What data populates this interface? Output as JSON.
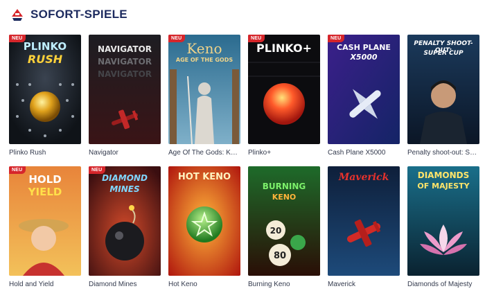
{
  "section": {
    "title": "SOFORT-SPIELE",
    "logo_icon": "flag-chip-icon"
  },
  "badge_text": "NEU",
  "games": [
    {
      "name": "Plinko Rush",
      "art_title": "PLINKO",
      "art_sub": "RUSH",
      "new": true
    },
    {
      "name": "Navigator",
      "art_title": "NAVIGATOR",
      "art_sub": "",
      "new": false
    },
    {
      "name": "Age Of The Gods: Keno",
      "art_title": "Keno",
      "art_sub": "AGE OF THE GODS",
      "new": true
    },
    {
      "name": "Plinko+",
      "art_title": "PLINKO+",
      "art_sub": "",
      "new": true
    },
    {
      "name": "Cash Plane X5000",
      "art_title": "CASH PLANE",
      "art_sub": "X5000",
      "new": true
    },
    {
      "name": "Penalty shoot-out: Supe...",
      "art_title": "PENALTY SHOOT-OUT:",
      "art_sub": "SUPER CUP",
      "new": false
    },
    {
      "name": "Hold and Yield",
      "art_title": "HOLD",
      "art_sub": "YIELD",
      "new": true
    },
    {
      "name": "Diamond Mines",
      "art_title": "DIAMOND",
      "art_sub": "MINES",
      "new": true
    },
    {
      "name": "Hot Keno",
      "art_title": "HOT KENO",
      "art_sub": "",
      "new": false
    },
    {
      "name": "Burning Keno",
      "art_title": "BURNING",
      "art_sub": "KENO",
      "new": false
    },
    {
      "name": "Maverick",
      "art_title": "Maverick",
      "art_sub": "",
      "new": false
    },
    {
      "name": "Diamonds of Majesty",
      "art_title": "DIAMONDS",
      "art_sub": "OF MAJESTY",
      "new": false
    }
  ],
  "colors": {
    "title": "#1c2a5e",
    "badge": "#d6262b",
    "label": "#333a4d"
  }
}
